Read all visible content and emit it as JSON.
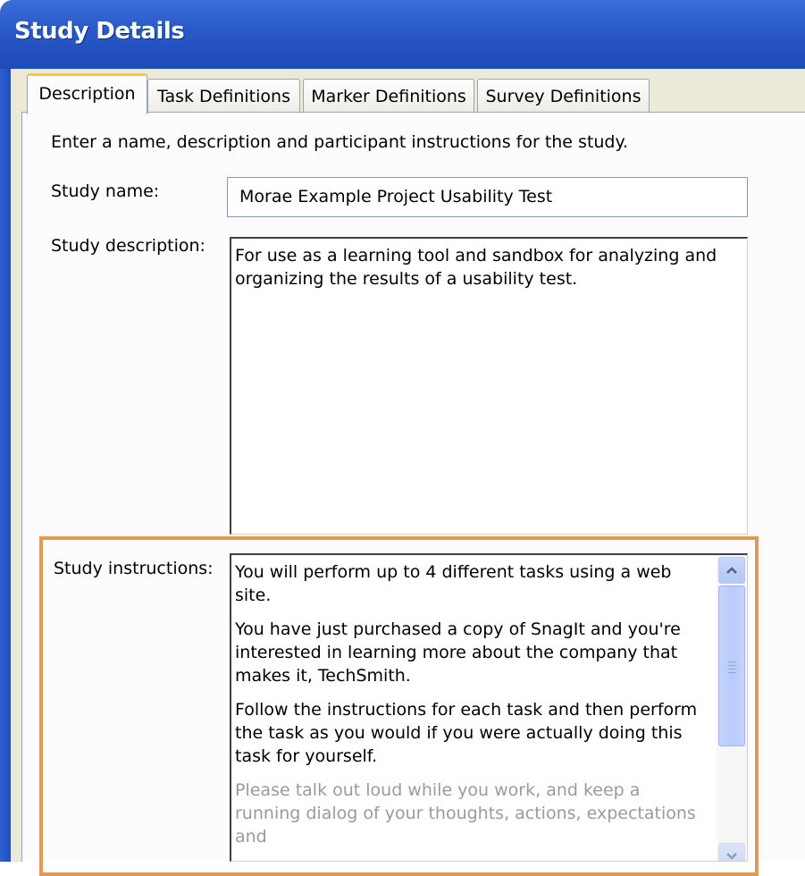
{
  "window": {
    "title": "Study Details"
  },
  "tabs": [
    {
      "label": "Description",
      "active": true
    },
    {
      "label": "Task Definitions",
      "active": false
    },
    {
      "label": "Marker Definitions",
      "active": false
    },
    {
      "label": "Survey Definitions",
      "active": false
    }
  ],
  "intro_text": "Enter a name, description and participant instructions for the study.",
  "study_name": {
    "label": "Study name:",
    "value": "Morae Example Project Usability Test"
  },
  "study_description": {
    "label": "Study description:",
    "value": "For use as a learning tool and sandbox for analyzing and organizing the results of a usability test."
  },
  "study_instructions": {
    "label": "Study instructions:",
    "paragraphs": [
      "You will perform up to 4 different tasks using a web site.",
      "You have just purchased a copy of SnagIt and you're interested in learning more about the company that makes it, TechSmith.",
      "Follow the instructions for each task and then perform the task as you would if you were actually doing this task for yourself.",
      "Please talk out loud while you work, and keep a running dialog of your thoughts, actions, expectations and"
    ]
  },
  "colors": {
    "titlebar": "#2958c8",
    "highlight_border": "#e39a4f",
    "active_tab_accent": "#ffc83c"
  },
  "icons": {
    "scroll_up": "chevron-up-icon",
    "scroll_down": "chevron-down-icon"
  }
}
